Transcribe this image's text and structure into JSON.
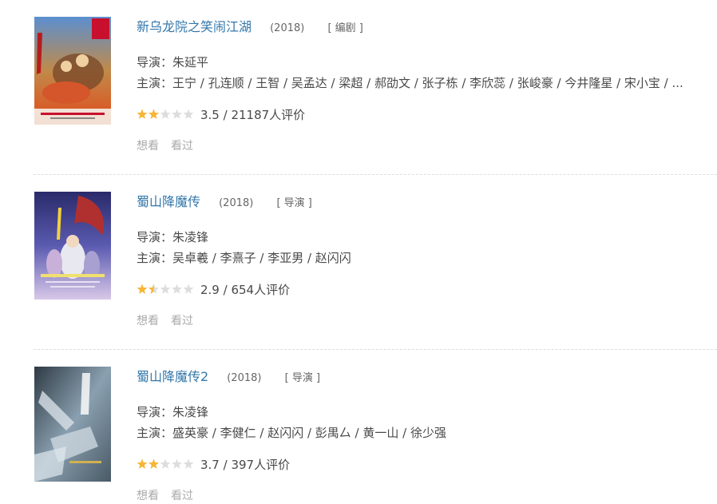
{
  "colors": {
    "title_link": "#3377aa",
    "text": "#494949",
    "muted": "#aaaaaa",
    "star_on": "#f8b535",
    "star_off": "#dddddd",
    "divider": "#dddddd"
  },
  "films": [
    {
      "title": "新乌龙院之笑闹江湖",
      "year": "(2018)",
      "role": "[ 编剧 ]",
      "director_label": "导演：",
      "director": "朱延平",
      "cast_label": "主演：",
      "cast": "王宁 / 孔连顺 / 王智 / 吴孟达 / 梁超 / 郝劭文 / 张子栋 / 李欣蕊 / 张峻豪 / 今井隆星 / 宋小宝 / ...",
      "rating": 3.5,
      "stars_out_of_5": 2,
      "rating_text": "3.5 / 21187人评价",
      "poster_icon": "poster-image",
      "want": "想看",
      "seen": "看过"
    },
    {
      "title": "蜀山降魔传",
      "year": "(2018)",
      "role": "[ 导演 ]",
      "director_label": "导演：",
      "director": "朱凌锋",
      "cast_label": "主演：",
      "cast": "吴卓羲 / 李熹子 / 李亚男 / 赵闪闪",
      "rating": 2.9,
      "stars_out_of_5": 1.5,
      "rating_text": "2.9 / 654人评价",
      "poster_icon": "poster-image",
      "want": "想看",
      "seen": "看过"
    },
    {
      "title": "蜀山降魔传2",
      "year": "(2018)",
      "role": "[ 导演 ]",
      "director_label": "导演：",
      "director": "朱凌锋",
      "cast_label": "主演：",
      "cast": "盛英豪 / 李健仁 / 赵闪闪 / 彭禺厶 / 黄一山 / 徐少强",
      "rating": 3.7,
      "stars_out_of_5": 2,
      "rating_text": "3.7 / 397人评价",
      "poster_icon": "poster-image",
      "want": "想看",
      "seen": "看过"
    }
  ]
}
